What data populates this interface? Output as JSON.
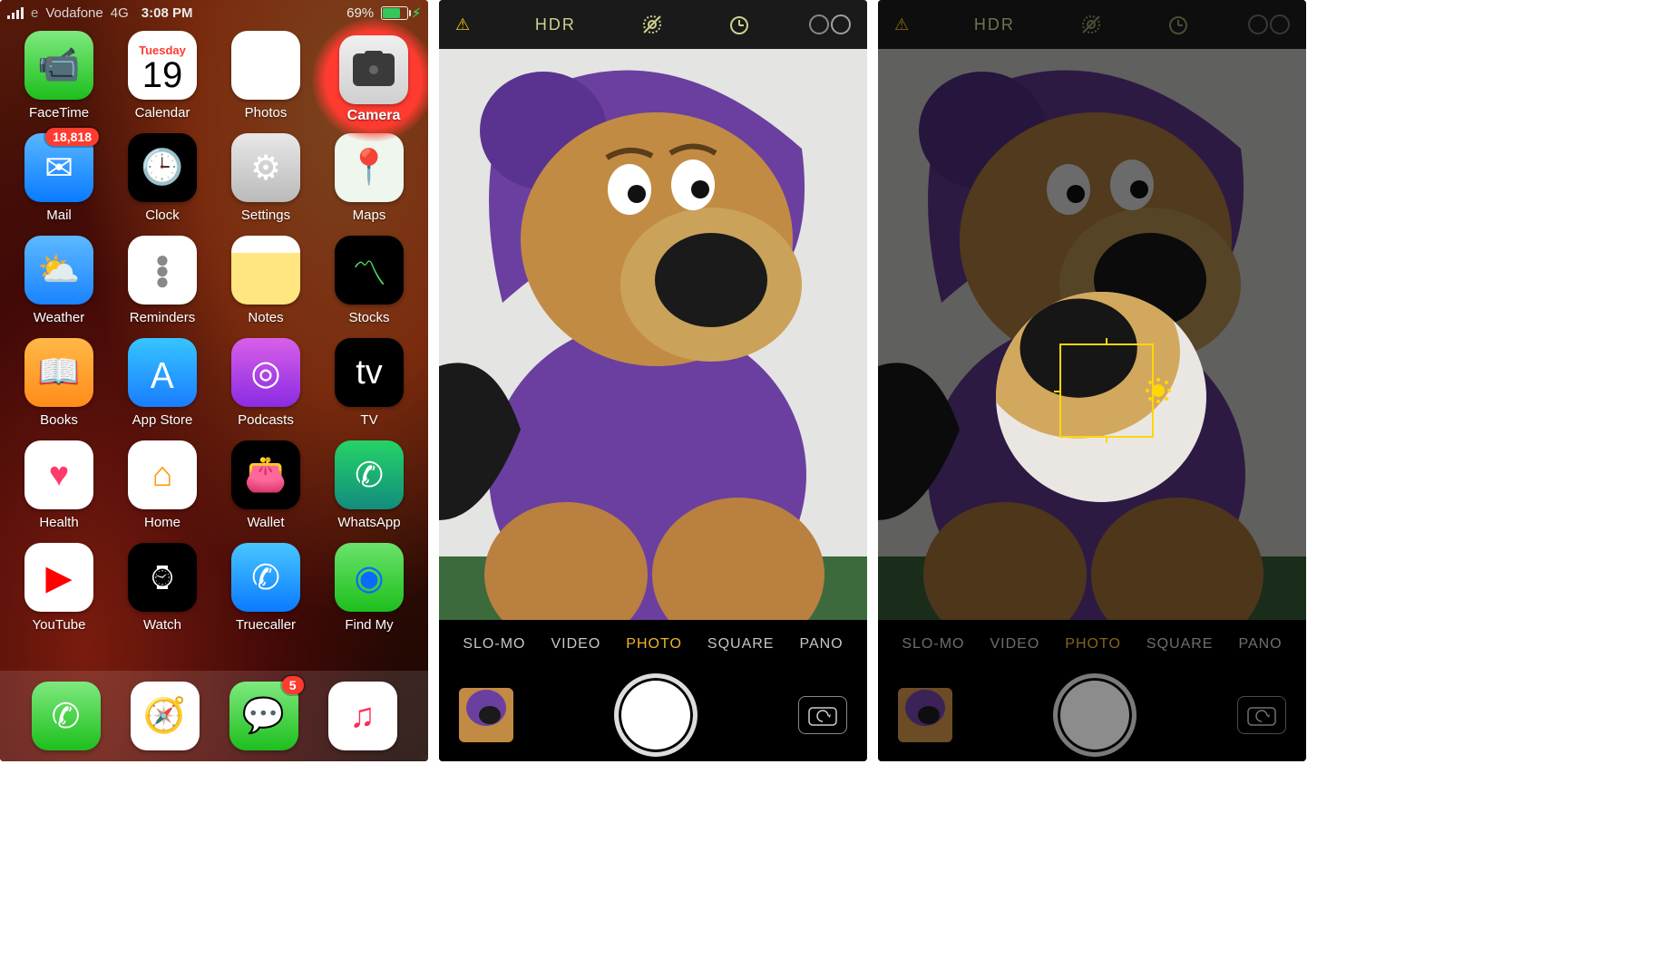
{
  "status_bar": {
    "carrier": "Vodafone",
    "network": "4G",
    "time": "3:08 PM",
    "battery_pct": "69%"
  },
  "home": {
    "cal": {
      "dow": "Tuesday",
      "day": "19"
    },
    "apps": {
      "facetime": "FaceTime",
      "calendar": "Calendar",
      "photos": "Photos",
      "camera": "Camera",
      "mail": "Mail",
      "mail_badge": "18,818",
      "clock": "Clock",
      "settings": "Settings",
      "maps": "Maps",
      "weather": "Weather",
      "reminders": "Reminders",
      "notes": "Notes",
      "stocks": "Stocks",
      "books": "Books",
      "appstore": "App Store",
      "podcasts": "Podcasts",
      "tv": "TV",
      "health": "Health",
      "home": "Home",
      "wallet": "Wallet",
      "whatsapp": "WhatsApp",
      "youtube": "YouTube",
      "watch": "Watch",
      "truecaller": "Truecaller",
      "findmy": "Find My",
      "messages_badge": "5"
    }
  },
  "camera": {
    "hdr": "HDR",
    "modes": {
      "slomo": "SLO-MO",
      "video": "VIDEO",
      "photo": "PHOTO",
      "square": "SQUARE",
      "pano": "PANO"
    }
  }
}
